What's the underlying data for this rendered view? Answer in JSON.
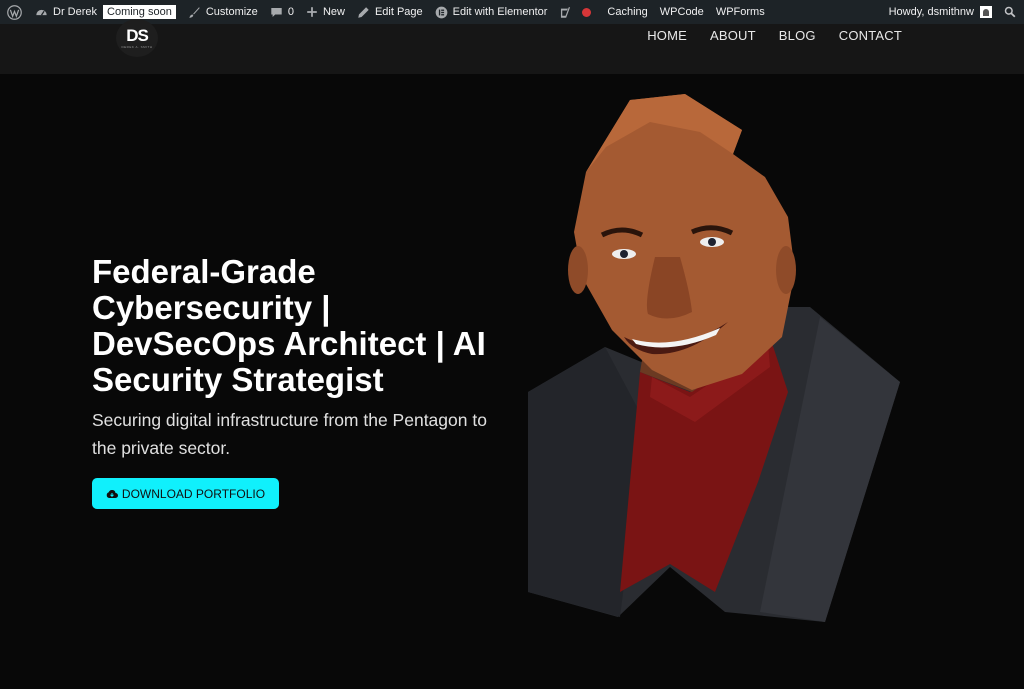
{
  "admin_bar": {
    "site_name": "Dr Derek",
    "coming_soon": "Coming soon",
    "customize": "Customize",
    "comments_count": "0",
    "new": "New",
    "edit_page": "Edit Page",
    "edit_elementor": "Edit with Elementor",
    "caching": "Caching",
    "wpcode": "WPCode",
    "wpforms": "WPForms",
    "howdy": "Howdy, dsmithnw"
  },
  "header": {
    "logo_text": "DS",
    "logo_subtext": "DEREK A. SMITH",
    "nav": [
      "HOME",
      "ABOUT",
      "BLOG",
      "CONTACT"
    ]
  },
  "hero": {
    "title": "Federal-Grade Cybersecurity | DevSecOps Architect | AI Security Strategist",
    "subtitle": "Securing digital infrastructure from the Pentagon to the private sector.",
    "cta_label": "DOWNLOAD PORTFOLIO"
  },
  "colors": {
    "admin_bar_bg": "#1d2327",
    "header_bg": "#161616",
    "page_bg": "#080808",
    "cta_bg": "#10f0fc",
    "status_dot": "#d63638"
  },
  "icons": [
    "wordpress-icon",
    "dashboard-icon",
    "brush-icon",
    "comment-icon",
    "plus-icon",
    "pencil-icon",
    "elementor-icon",
    "yoast-icon",
    "search-icon",
    "cloud-download-icon"
  ]
}
